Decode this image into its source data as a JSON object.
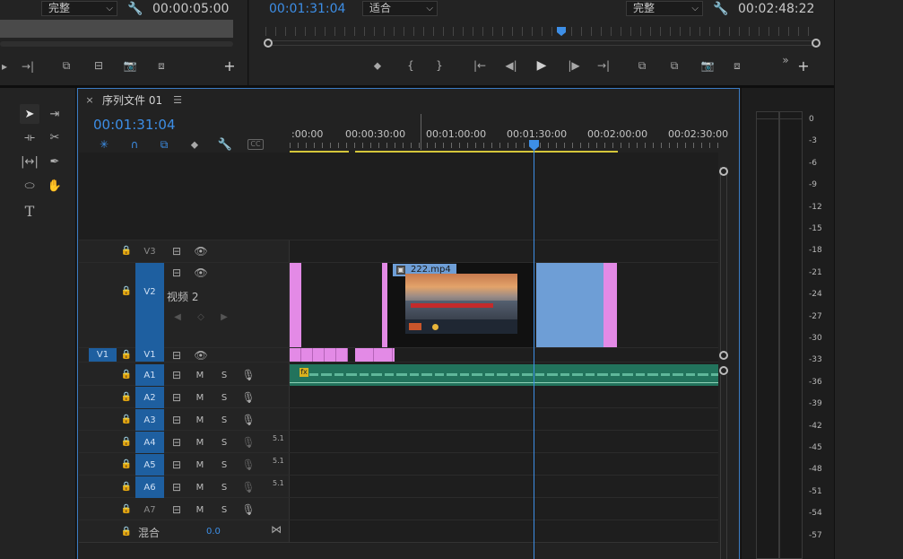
{
  "source_monitor": {
    "zoom_select": "完整",
    "timecode": "00:00:05:00"
  },
  "program_monitor": {
    "timecode_current": "00:01:31:04",
    "fit_select": "适合",
    "quality_select": "完整",
    "timecode_duration": "00:02:48:22"
  },
  "timeline": {
    "tab_title": "序列文件 01",
    "tab_close": "×",
    "tab_menu": "☰",
    "timecode": "00:01:31:04",
    "ruler_labels": [
      ":00:00",
      "00:00:30:00",
      "00:01:00:00",
      "00:01:30:00",
      "00:02:00:00",
      "00:02:30:00"
    ],
    "tracks": {
      "v3": "V3",
      "v2": "V2",
      "v2_name": "视频 2",
      "v1": "V1",
      "v1_source": "V1",
      "a1": "A1",
      "a2": "A2",
      "a3": "A3",
      "a4": "A4",
      "a5": "A5",
      "a6": "A6",
      "a7": "A7",
      "m": "M",
      "s": "S",
      "ch51": "5.1",
      "mix_label": "混合",
      "mix_value": "0.0"
    },
    "clip_name": "222.mp4",
    "fx_badge": "fx"
  },
  "meter": {
    "db_labels": [
      "0",
      "-3",
      "-6",
      "-9",
      "-12",
      "-15",
      "-18",
      "-21",
      "-24",
      "-27",
      "-30",
      "-33",
      "-36",
      "-39",
      "-42",
      "-45",
      "-48",
      "-51",
      "-54",
      "-57"
    ]
  },
  "colors": {
    "accent_blue": "#3d8ee6",
    "track_blue": "#1e5fa0",
    "clip_pink": "#e38ae6",
    "clip_blue": "#6e9ed6",
    "audio_green": "#22735c",
    "inout_yellow": "#d4c63a"
  }
}
